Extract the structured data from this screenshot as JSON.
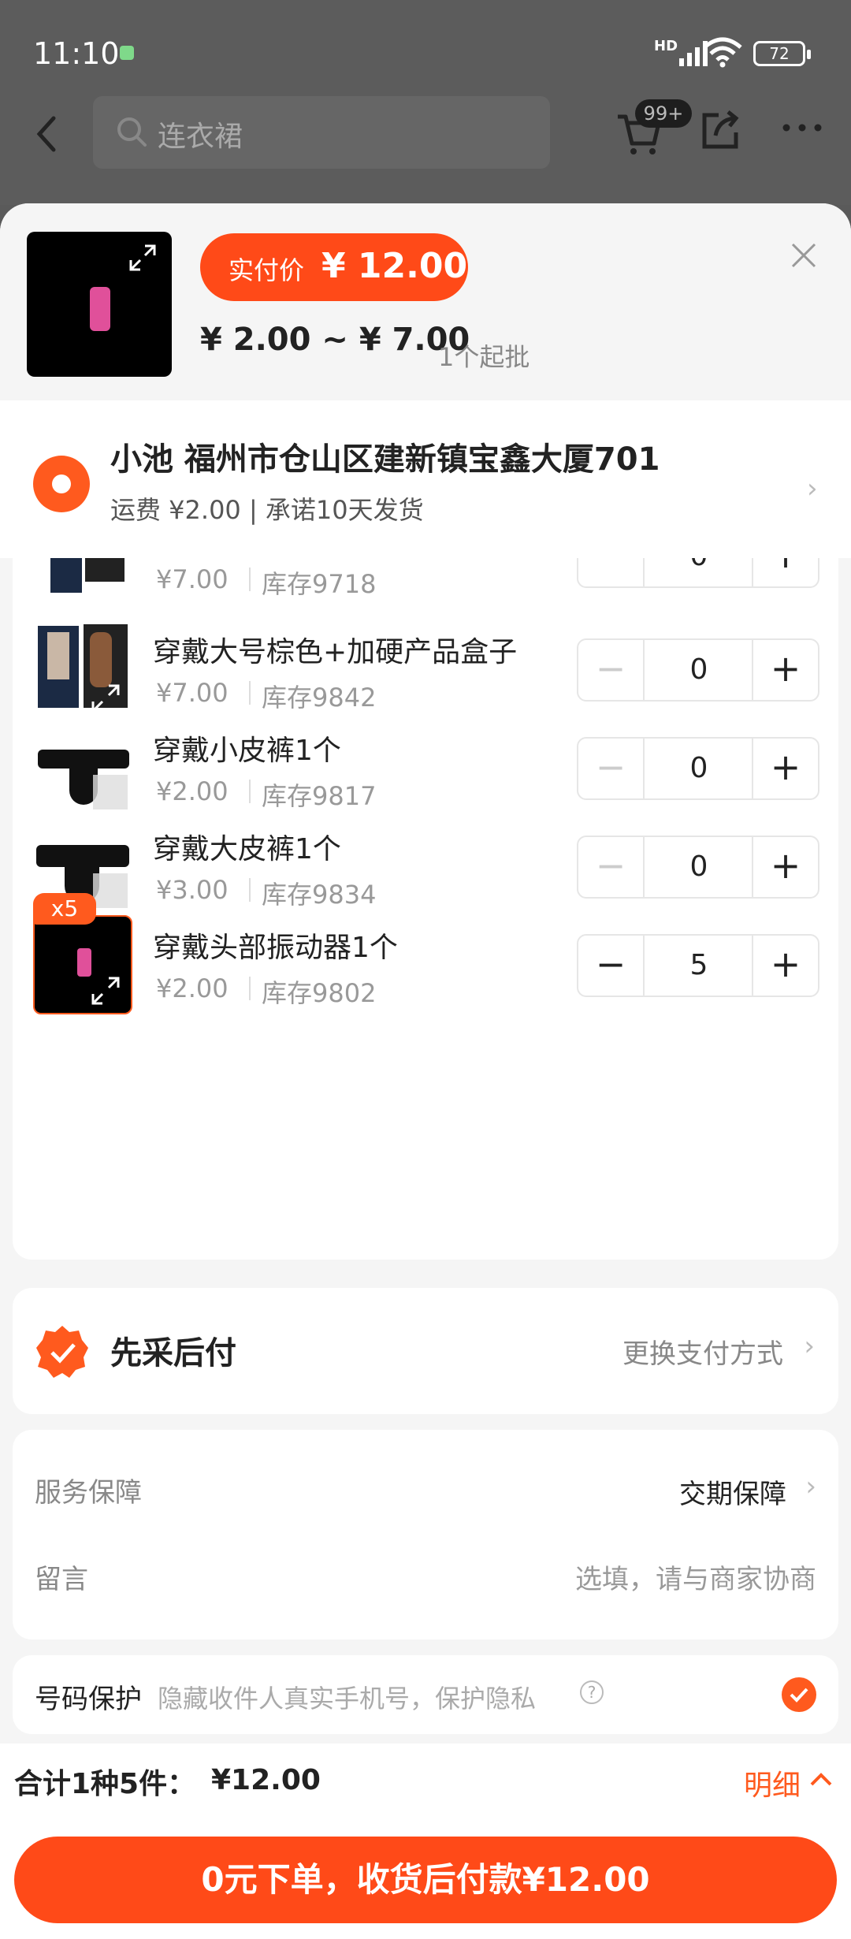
{
  "status_bar": {
    "time": "11:10",
    "network": "HD",
    "battery": "72"
  },
  "nav": {
    "search_text": "连衣裙",
    "cart_badge": "99+"
  },
  "sheet": {
    "pay_label": "实付价",
    "pay_value": "¥ 12.00",
    "price_range": "¥ 2.00 ~ ¥ 7.00",
    "moq": "1个起批"
  },
  "address": {
    "line": "小池 福州市仓山区建新镇宝鑫大厦701",
    "shipping": "运费 ¥2.00 | 承诺10天发货"
  },
  "items": [
    {
      "name": "",
      "price": "¥7.00",
      "stock": "库存9718",
      "qty": "0"
    },
    {
      "name": "穿戴大号棕色+加硬产品盒子",
      "price": "¥7.00",
      "stock": "库存9842",
      "qty": "0"
    },
    {
      "name": "穿戴小皮裤1个",
      "price": "¥2.00",
      "stock": "库存9817",
      "qty": "0"
    },
    {
      "name": "穿戴大皮裤1个",
      "price": "¥3.00",
      "stock": "库存9834",
      "qty": "0"
    },
    {
      "name": "穿戴头部振动器1个",
      "price": "¥2.00",
      "stock": "库存9802",
      "qty": "5",
      "badge": "x5"
    }
  ],
  "payment": {
    "title": "先采后付",
    "change": "更换支付方式"
  },
  "service": {
    "label": "服务保障",
    "value": "交期保障",
    "msg_label": "留言",
    "msg_placeholder": "选填，请与商家协商"
  },
  "phone": {
    "label": "号码保护",
    "hint": "隐藏收件人真实手机号，保护隐私"
  },
  "footer": {
    "total_label": "合计1种5件：",
    "total_value": "¥12.00",
    "detail": "明细",
    "cta": "0元下单，收货后付款¥12.00"
  },
  "colors": {
    "accent": "#ff4a18"
  }
}
